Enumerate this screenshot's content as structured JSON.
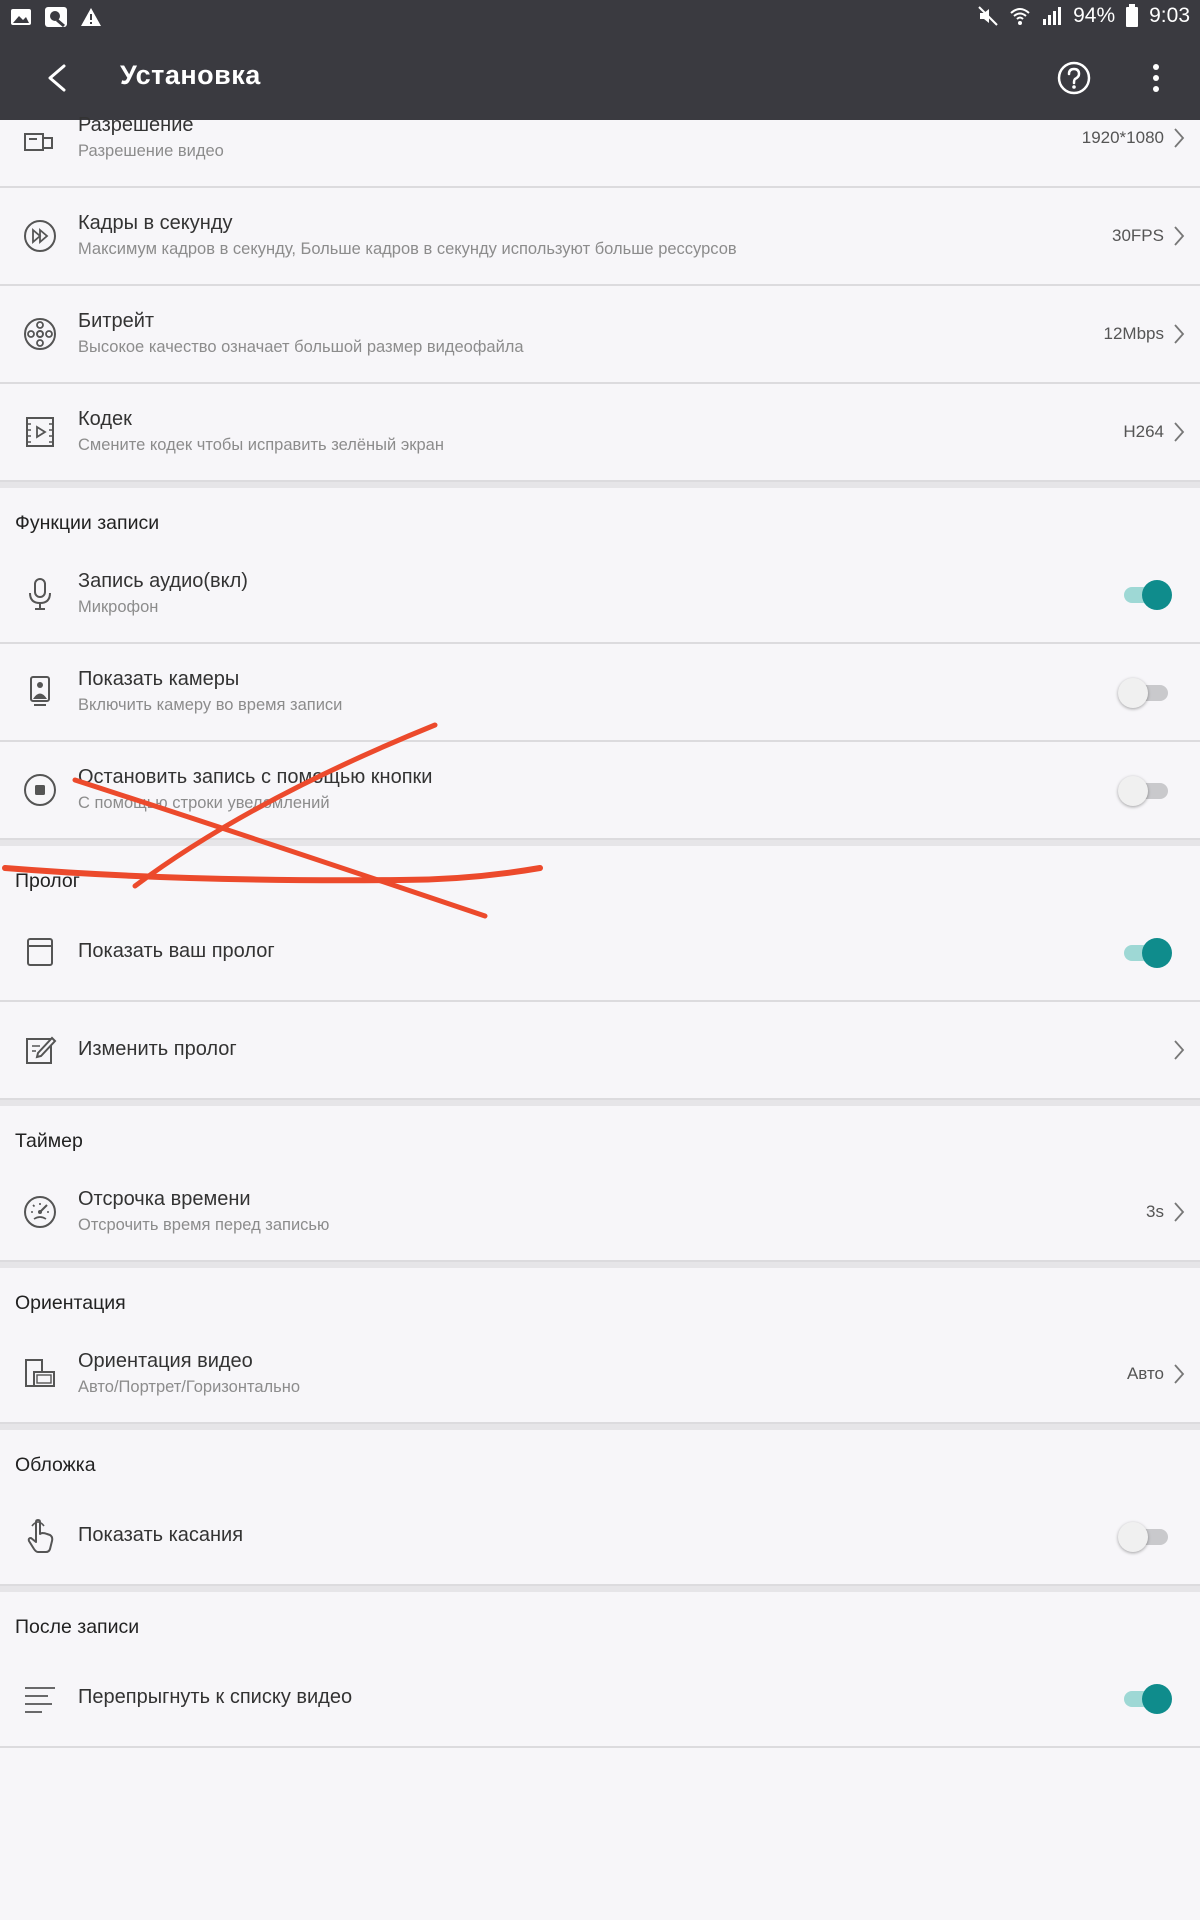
{
  "status_bar": {
    "battery": "94%",
    "time": "9:03",
    "left_icons": [
      "gallery-icon",
      "screen-recorder-icon",
      "warning-icon"
    ],
    "right_icons": [
      "mute-icon",
      "wifi-icon",
      "signal-icon",
      "battery-icon"
    ]
  },
  "toolbar": {
    "title": "Установка",
    "icons": [
      "back-icon",
      "help-icon",
      "more-icon"
    ]
  },
  "video_settings": [
    {
      "title": "Разрешение",
      "subtitle": "Разрешение видео",
      "value": "1920*1080"
    },
    {
      "title": "Кадры в секунду",
      "subtitle": "Максимум кадров в секунду, Больше кадров в секунду используют больше рессурсов",
      "value": "30FPS"
    },
    {
      "title": "Битрейт",
      "subtitle": "Высокое качество означает большой размер видеофайла",
      "value": "12Mbps"
    },
    {
      "title": "Кодек",
      "subtitle": "Смените кодек чтобы исправить зелёный экран",
      "value": "H264"
    }
  ],
  "recording": {
    "header": "Функции записи",
    "items": [
      {
        "title": "Запись аудио(вкл)",
        "subtitle": "Микрофон",
        "toggle": true
      },
      {
        "title": "Показать камеры",
        "subtitle": "Включить камеру во время записи",
        "toggle": false
      },
      {
        "title": "Остановить запись с помощью кнопки",
        "subtitle": "С помощью строки увеломлений",
        "toggle": false
      }
    ]
  },
  "prologue": {
    "header": "Пролог",
    "items": [
      {
        "title": "Показать ваш пролог",
        "toggle": true
      },
      {
        "title": "Изменить пролог"
      }
    ]
  },
  "timer": {
    "header": "Таймер",
    "items": [
      {
        "title": "Отсрочка времени",
        "subtitle": "Отсрочить время перед записью",
        "value": "3s"
      }
    ]
  },
  "orientation": {
    "header": "Ориентация",
    "items": [
      {
        "title": "Ориентация видео",
        "subtitle": "Авто/Портрет/Горизонтально",
        "value": "Авто"
      }
    ]
  },
  "cover": {
    "header": "Обложка",
    "items": [
      {
        "title": "Показать касания",
        "toggle": false
      }
    ]
  },
  "after_recording": {
    "header": "После записи",
    "items": [
      {
        "title": "Перепрыгнуть к списку видео",
        "toggle": true
      }
    ]
  },
  "colors": {
    "toolbar": "#3a3a40",
    "accent": "#0f8c8c",
    "annotation": "#ec4a2c"
  }
}
